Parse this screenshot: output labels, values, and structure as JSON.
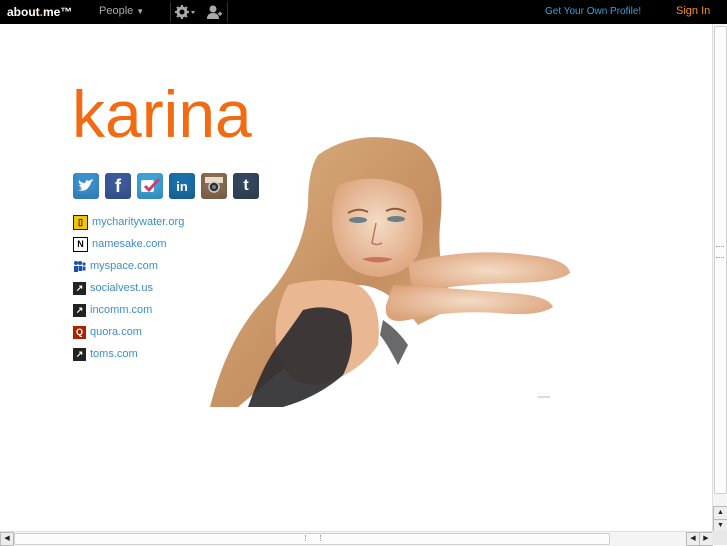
{
  "topbar": {
    "logo_main": "about",
    "logo_dot": ".",
    "logo_me": "me™",
    "people_label": "People",
    "get_own_label": "Get Your Own Profile!",
    "sign_in_label": "Sign In"
  },
  "profile": {
    "name": "karina"
  },
  "social_icons": [
    "twitter-icon",
    "facebook-icon",
    "foursquare-icon",
    "linkedin-icon",
    "instagram-icon",
    "tumblr-icon"
  ],
  "links": [
    {
      "label": "mycharitywater.org",
      "icon": "charitywater-icon"
    },
    {
      "label": "namesake.com",
      "icon": "namesake-icon"
    },
    {
      "label": "myspace.com",
      "icon": "myspace-icon"
    },
    {
      "label": "socialvest.us",
      "icon": "external-link-icon"
    },
    {
      "label": "incomm.com",
      "icon": "external-link-icon"
    },
    {
      "label": "quora.com",
      "icon": "quora-icon"
    },
    {
      "label": "toms.com",
      "icon": "external-link-icon"
    }
  ],
  "colors": {
    "accent": "#f26a12",
    "link": "#3b8fc8",
    "topbar": "#000000"
  }
}
